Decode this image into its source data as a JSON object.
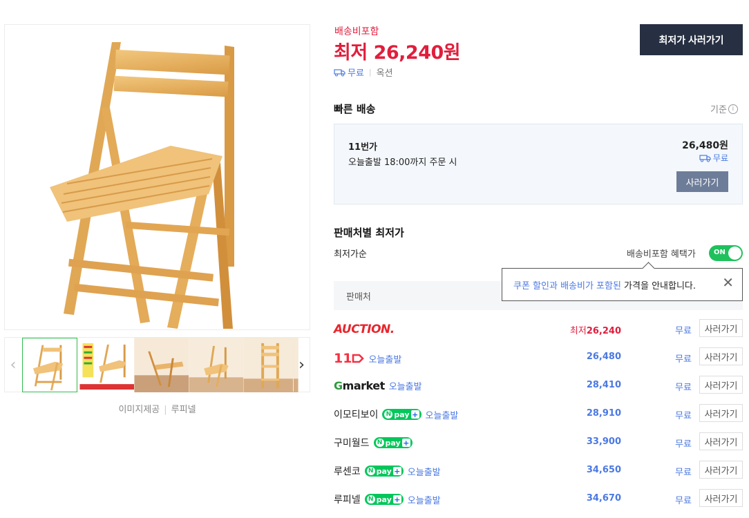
{
  "images": {
    "thumbnails": [
      "chair-1",
      "chair-2",
      "chair-3",
      "chair-4",
      "chair-5"
    ],
    "credit_label": "이미지제공",
    "credit_mall": "루피넬"
  },
  "summary": {
    "ship_included": "배송비포함",
    "lowest_price": "최저 26,240원",
    "ship_free": "무료",
    "options": "옥션",
    "buy_button": "최저가 사러가기"
  },
  "fast_delivery": {
    "title": "빠른 배송",
    "criteria": "기준",
    "mall": "11번가",
    "desc": "오늘출발 18:00까지 주문 시",
    "price": "26,480원",
    "shipping": "무료",
    "buy": "사러가기"
  },
  "seller_list": {
    "title": "판매처별 최저가",
    "sort": "최저가순",
    "benefit_label": "배송비포함 혜택가",
    "toggle": "ON",
    "header_seller": "판매처",
    "tooltip": {
      "highlight": "쿠폰 할인과 배송비가 포함된",
      "rest": " 가격을 안내합니다."
    },
    "rows": [
      {
        "mall": "AUCTION.",
        "logo": "auction",
        "badge": "",
        "today": "",
        "price_prefix": "최저",
        "price": "26,240",
        "shipping": "무료",
        "buy": "사러가기"
      },
      {
        "mall": "11",
        "logo": "11st",
        "badge": "",
        "today": "오늘출발",
        "price_prefix": "",
        "price": "26,480",
        "shipping": "무료",
        "buy": "사러가기"
      },
      {
        "mall": "Gmarket",
        "logo": "gmarket",
        "badge": "",
        "today": "오늘출발",
        "price_prefix": "",
        "price": "28,410",
        "shipping": "무료",
        "buy": "사러가기"
      },
      {
        "mall": "이모티보이",
        "logo": "text",
        "badge": "npay",
        "today": "오늘출발",
        "price_prefix": "",
        "price": "28,910",
        "shipping": "무료",
        "buy": "사러가기"
      },
      {
        "mall": "구미월드",
        "logo": "text",
        "badge": "npay",
        "today": "",
        "price_prefix": "",
        "price": "33,900",
        "shipping": "무료",
        "buy": "사러가기"
      },
      {
        "mall": "루센코",
        "logo": "text",
        "badge": "npay",
        "today": "오늘출발",
        "price_prefix": "",
        "price": "34,650",
        "shipping": "무료",
        "buy": "사러가기"
      },
      {
        "mall": "루피넬",
        "logo": "text",
        "badge": "npay",
        "today": "오늘출발",
        "price_prefix": "",
        "price": "34,670",
        "shipping": "무료",
        "buy": "사러가기"
      }
    ]
  },
  "npay_label": "pay",
  "colors": {
    "accent_red": "#e01e3c",
    "link_blue": "#4b79e2",
    "dark_button": "#273042",
    "toggle_green": "#1fc15d"
  }
}
